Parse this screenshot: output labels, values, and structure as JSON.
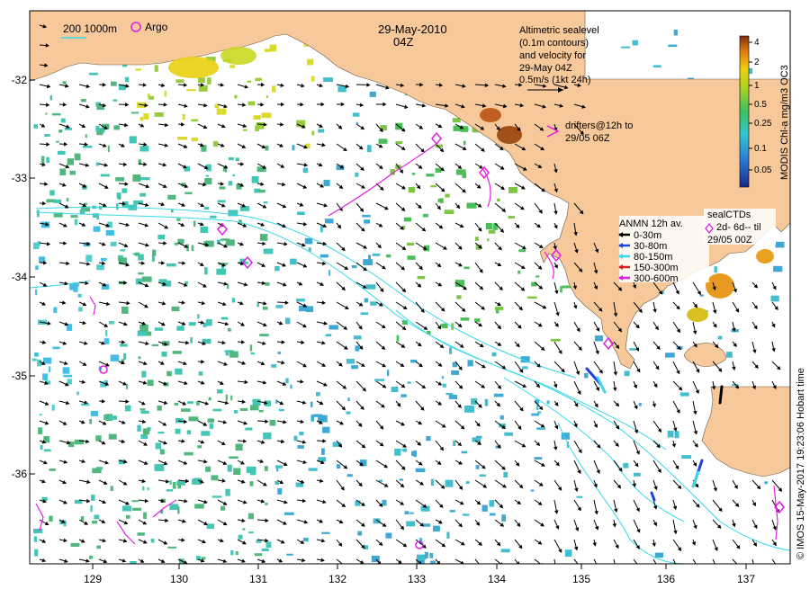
{
  "map": {
    "date": "29-May-2010",
    "time": "04Z",
    "bathy_legend": "200  1000m",
    "argo_label": "Argo",
    "altimetry_lines": [
      "Altimetric sealevel",
      "(0.1m contours)",
      "and velocity for",
      "29-May 04Z",
      "0.5m/s (1kt 24h)"
    ],
    "drifters_lines": [
      "drifters@12h to",
      "29/05 06Z"
    ],
    "anmn_title": "ANMN 12h av.",
    "anmn_items": [
      {
        "label": "0-30m",
        "color": "#000000"
      },
      {
        "label": "30-80m",
        "color": "#1f3fe0"
      },
      {
        "label": "80-150m",
        "color": "#38d8e8"
      },
      {
        "label": "150-300m",
        "color": "#d82020"
      },
      {
        "label": "300-600m",
        "color": "#e020e0"
      }
    ],
    "sealctd_lines": [
      "sealCTDs",
      "2d- 6d-- til",
      "29/05 00Z"
    ],
    "colorbar_title": "MODIS Chl-a mg/m3 OC3",
    "colorbar_ticks": [
      "4",
      "2",
      "1",
      "0.5",
      "0.25",
      "0.1",
      "0.05"
    ],
    "credit": "© IMOS 15-May-2017 19:23:06 Hobart time",
    "x_ticks": [
      "129",
      "130",
      "131",
      "132",
      "133",
      "134",
      "135",
      "136",
      "137"
    ],
    "y_ticks": [
      "-32",
      "-33",
      "-34",
      "-35",
      "-36"
    ],
    "colors": {
      "land": "#f6c89a",
      "sea": "#ffffff",
      "argo": "#e020e0",
      "bathy": "#38d8e8"
    }
  }
}
